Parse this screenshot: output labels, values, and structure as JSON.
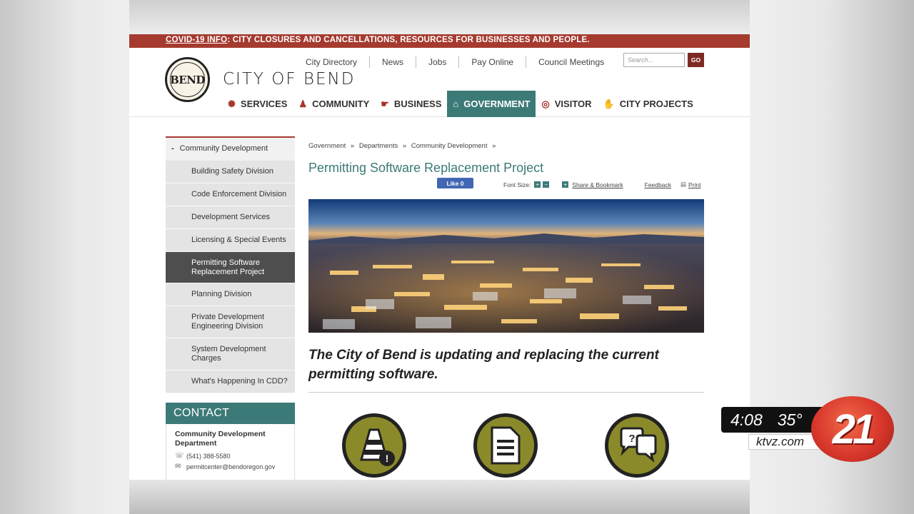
{
  "covid_banner": {
    "lead": "COVID-19 INFO",
    "rest": ": CITY CLOSURES AND CANCELLATIONS, RESOURCES FOR BUSINESSES AND PEOPLE."
  },
  "header": {
    "seal_text": "BEND",
    "city_name": "CITY OF BEND",
    "utility_links": [
      "City Directory",
      "News",
      "Jobs",
      "Pay Online",
      "Council Meetings"
    ],
    "search_placeholder": "Search...",
    "go_label": "GO"
  },
  "main_nav": [
    {
      "label": "SERVICES",
      "icon": "gears-icon"
    },
    {
      "label": "COMMUNITY",
      "icon": "people-icon"
    },
    {
      "label": "BUSINESS",
      "icon": "handshake-icon"
    },
    {
      "label": "GOVERNMENT",
      "icon": "building-icon",
      "active": true
    },
    {
      "label": "VISITOR",
      "icon": "binoculars-icon"
    },
    {
      "label": "CITY PROJECTS",
      "icon": "hand-icon"
    }
  ],
  "sidebar": {
    "header": "Community Development",
    "items": [
      "Building Safety Division",
      "Code Enforcement Division",
      "Development Services",
      "Licensing & Special Events",
      "Permitting Software Replacement Project",
      "Planning Division",
      "Private Development Engineering Division",
      "System Development Charges",
      "What's Happening In CDD?"
    ],
    "active_index": 4
  },
  "contact": {
    "title": "CONTACT",
    "org": "Community Development Department",
    "phone": "(541) 388-5580",
    "email": "permitcenter@bendoregon.gov"
  },
  "breadcrumb": [
    "Government",
    "»",
    "Departments",
    "»",
    "Community Development",
    "»"
  ],
  "page_title": "Permitting Software Replacement Project",
  "tools": {
    "like_label": "Like 0",
    "font_size_label": "Font Size:",
    "share_label": "Share & Bookmark",
    "feedback_label": "Feedback",
    "print_label": "Print"
  },
  "headline": "The City of Bend is updating and replacing the current permitting software.",
  "feature_icons": [
    "traffic-cone-alert-icon",
    "document-icon",
    "chat-question-icon"
  ],
  "tv_bug": {
    "time": "4:08",
    "temp": "35°",
    "url": "ktvz.com",
    "logo": "21"
  },
  "colors": {
    "banner_red": "#a53a2f",
    "teal": "#3c7a78",
    "olive": "#8a8a2a"
  }
}
